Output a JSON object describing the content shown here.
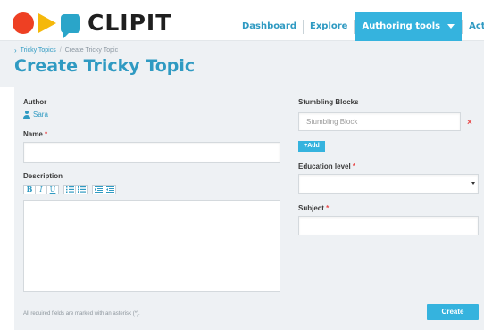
{
  "brand": {
    "name": "CLIPIT",
    "colors": {
      "red": "#ee4023",
      "yellow": "#f5b80a",
      "blue": "#2aa5c9",
      "accent": "#35b3de"
    }
  },
  "nav": {
    "items": [
      {
        "label": "Dashboard"
      },
      {
        "label": "Explore"
      },
      {
        "label": "Authoring tools"
      },
      {
        "label": "Activiti"
      }
    ]
  },
  "breadcrumb": {
    "items": [
      "Tricky Topics",
      "Create Tricky Topic"
    ]
  },
  "page": {
    "title": "Create Tricky Topic"
  },
  "form": {
    "author": {
      "label": "Author",
      "value": "Sara",
      "icon": "user-icon"
    },
    "name": {
      "label": "Name",
      "required_mark": "*",
      "value": ""
    },
    "description": {
      "label": "Description",
      "toolbar": {
        "bold": "B",
        "italic": "I",
        "underline": "U",
        "icons": [
          "bullet-list-icon",
          "numbered-list-icon",
          "indent-icon",
          "outdent-icon"
        ]
      }
    },
    "stumbling_blocks": {
      "label": "Stumbling Blocks",
      "placeholder": "Stumbling Block",
      "add_label": "+Add",
      "remove_icon": "×"
    },
    "education_level": {
      "label": "Education level",
      "required_mark": "*",
      "value": ""
    },
    "subject": {
      "label": "Subject",
      "required_mark": "*",
      "value": ""
    },
    "note": "All required fields are marked with an asterisk (*).",
    "submit_label": "Create"
  }
}
